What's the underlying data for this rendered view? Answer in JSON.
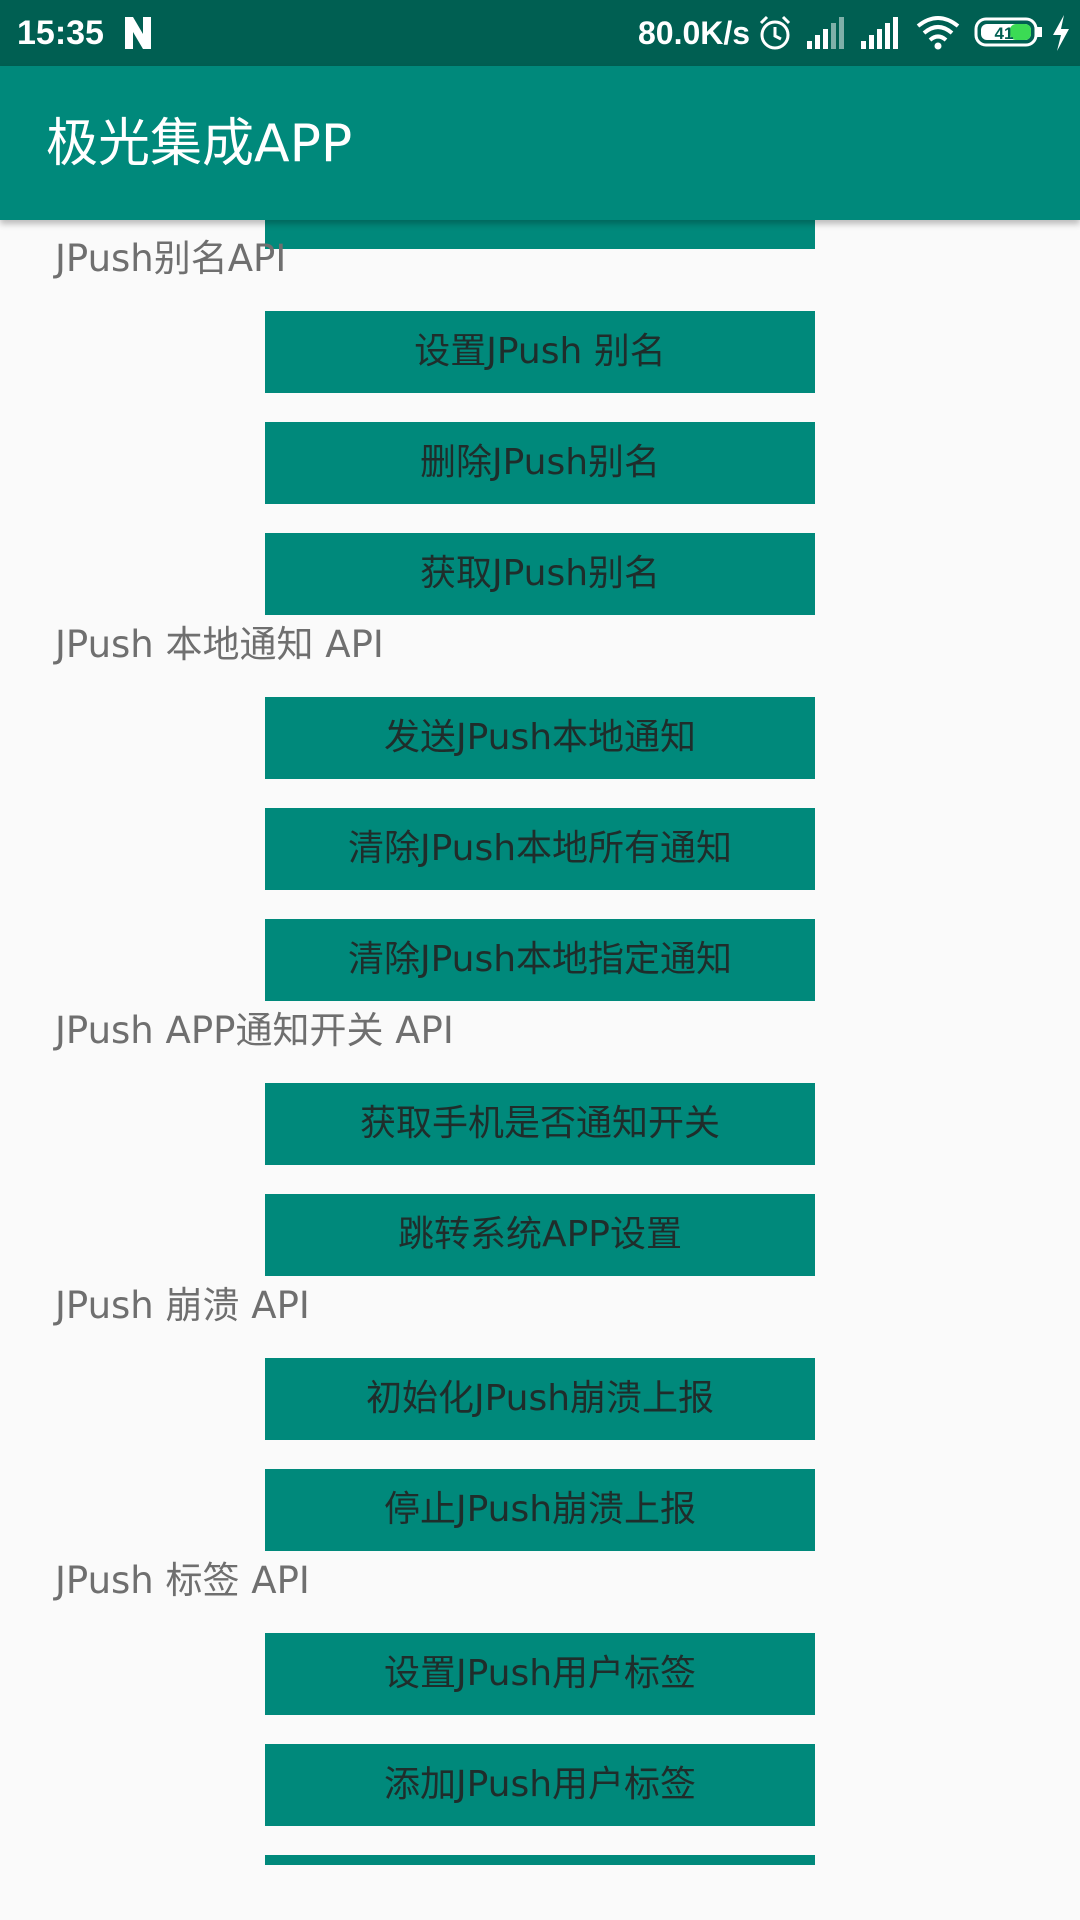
{
  "status_bar": {
    "time": "15:35",
    "net_speed": "80.0K/s",
    "battery_level": "41",
    "icons": [
      "n-notification-icon",
      "alarm-icon",
      "signal-icon",
      "signal-icon",
      "wifi-icon",
      "battery-icon",
      "charging-icon"
    ]
  },
  "app_bar": {
    "title": "极光集成APP"
  },
  "sections": {
    "alias": {
      "label": "JPush别名API",
      "buttons": [
        "设置JPush 别名",
        "删除JPush别名",
        "获取JPush别名"
      ]
    },
    "local_notification": {
      "label": "JPush 本地通知 API",
      "buttons": [
        "发送JPush本地通知",
        "清除JPush本地所有通知",
        "清除JPush本地指定通知"
      ]
    },
    "notification_switch": {
      "label": "JPush APP通知开关 API",
      "buttons": [
        "获取手机是否通知开关",
        "跳转系统APP设置"
      ]
    },
    "crash": {
      "label": "JPush 崩溃 API",
      "buttons": [
        "初始化JPush崩溃上报",
        "停止JPush崩溃上报"
      ]
    },
    "tags": {
      "label": "JPush 标签 API",
      "buttons": [
        "设置JPush用户标签",
        "添加JPush用户标签"
      ]
    }
  },
  "colors": {
    "primary": "#00897b",
    "primary_dark": "#005f52",
    "background": "#fafafa",
    "section_text": "#6f6f6f",
    "button_text": "#1f2d2b"
  }
}
